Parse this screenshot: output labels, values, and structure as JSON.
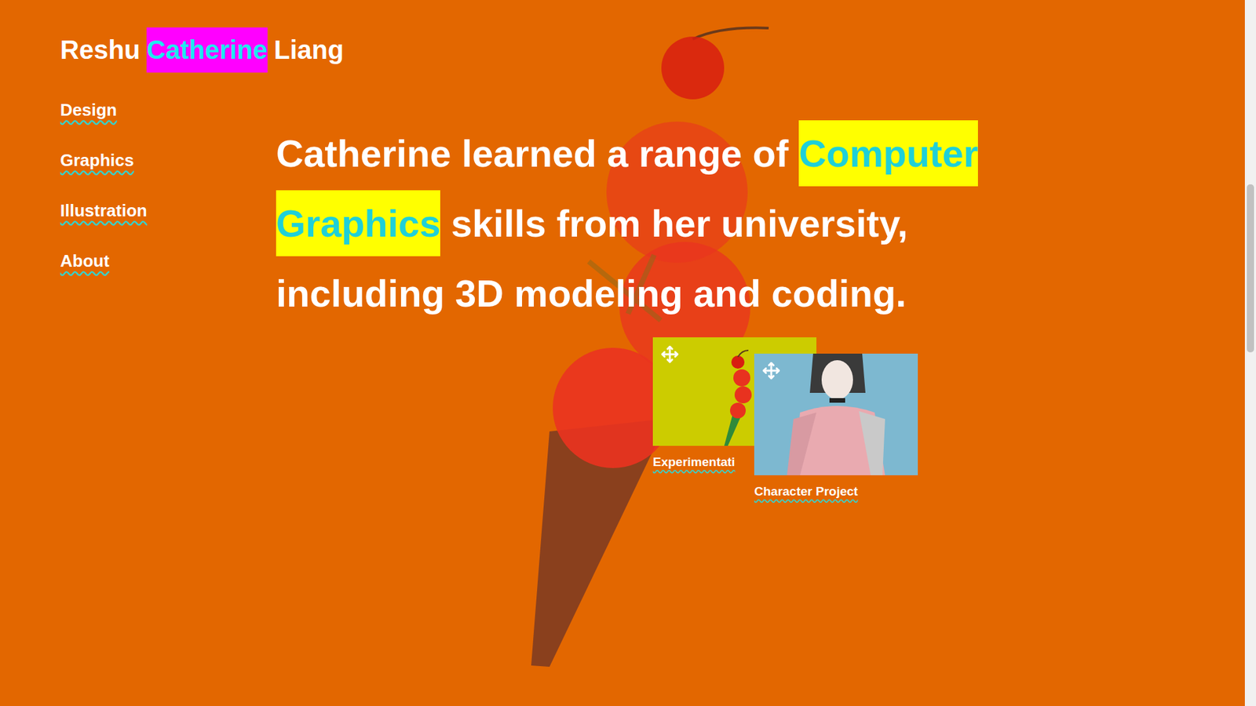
{
  "site": {
    "title_parts": [
      {
        "text": "Reshu",
        "highlighted": false
      },
      {
        "text": "Catherine",
        "highlighted": true
      },
      {
        "text": "Liang",
        "highlighted": false
      }
    ]
  },
  "nav": [
    {
      "label": "Design"
    },
    {
      "label": "Graphics"
    },
    {
      "label": "Illustration"
    },
    {
      "label": "About"
    }
  ],
  "intro": {
    "parts": [
      {
        "text": "Catherine learned a range of ",
        "highlighted": false
      },
      {
        "text": "Computer Graphics",
        "highlighted": true
      },
      {
        "text": " skills from her university, including 3D modeling and coding.",
        "highlighted": false
      }
    ]
  },
  "cards": [
    {
      "label": "Experimentati",
      "kind": "experiment",
      "color": "#cccc00"
    },
    {
      "label": "Character Project",
      "kind": "character",
      "color": "#7db8d0"
    }
  ]
}
